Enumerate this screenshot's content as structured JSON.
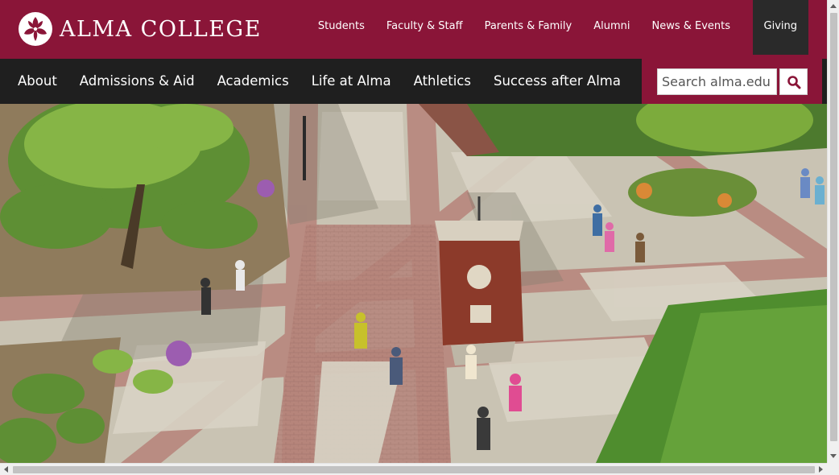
{
  "brand": {
    "name": "ALMA COLLEGE",
    "primary_color": "#8a1538",
    "dark_color": "#1f1f1f"
  },
  "utility_nav": {
    "items": [
      {
        "label": "Students"
      },
      {
        "label": "Faculty & Staff"
      },
      {
        "label": "Parents & Family"
      },
      {
        "label": "Alumni"
      },
      {
        "label": "News & Events"
      }
    ],
    "giving_label": "Giving"
  },
  "main_nav": {
    "items": [
      {
        "label": "About"
      },
      {
        "label": "Admissions & Aid"
      },
      {
        "label": "Academics"
      },
      {
        "label": "Life at Alma"
      },
      {
        "label": "Athletics"
      },
      {
        "label": "Success after Alma"
      }
    ]
  },
  "search": {
    "placeholder": "Search alma.edu",
    "value": "",
    "button_icon": "search-icon"
  },
  "hero": {
    "image": "aerial-campus-plaza-photo"
  }
}
